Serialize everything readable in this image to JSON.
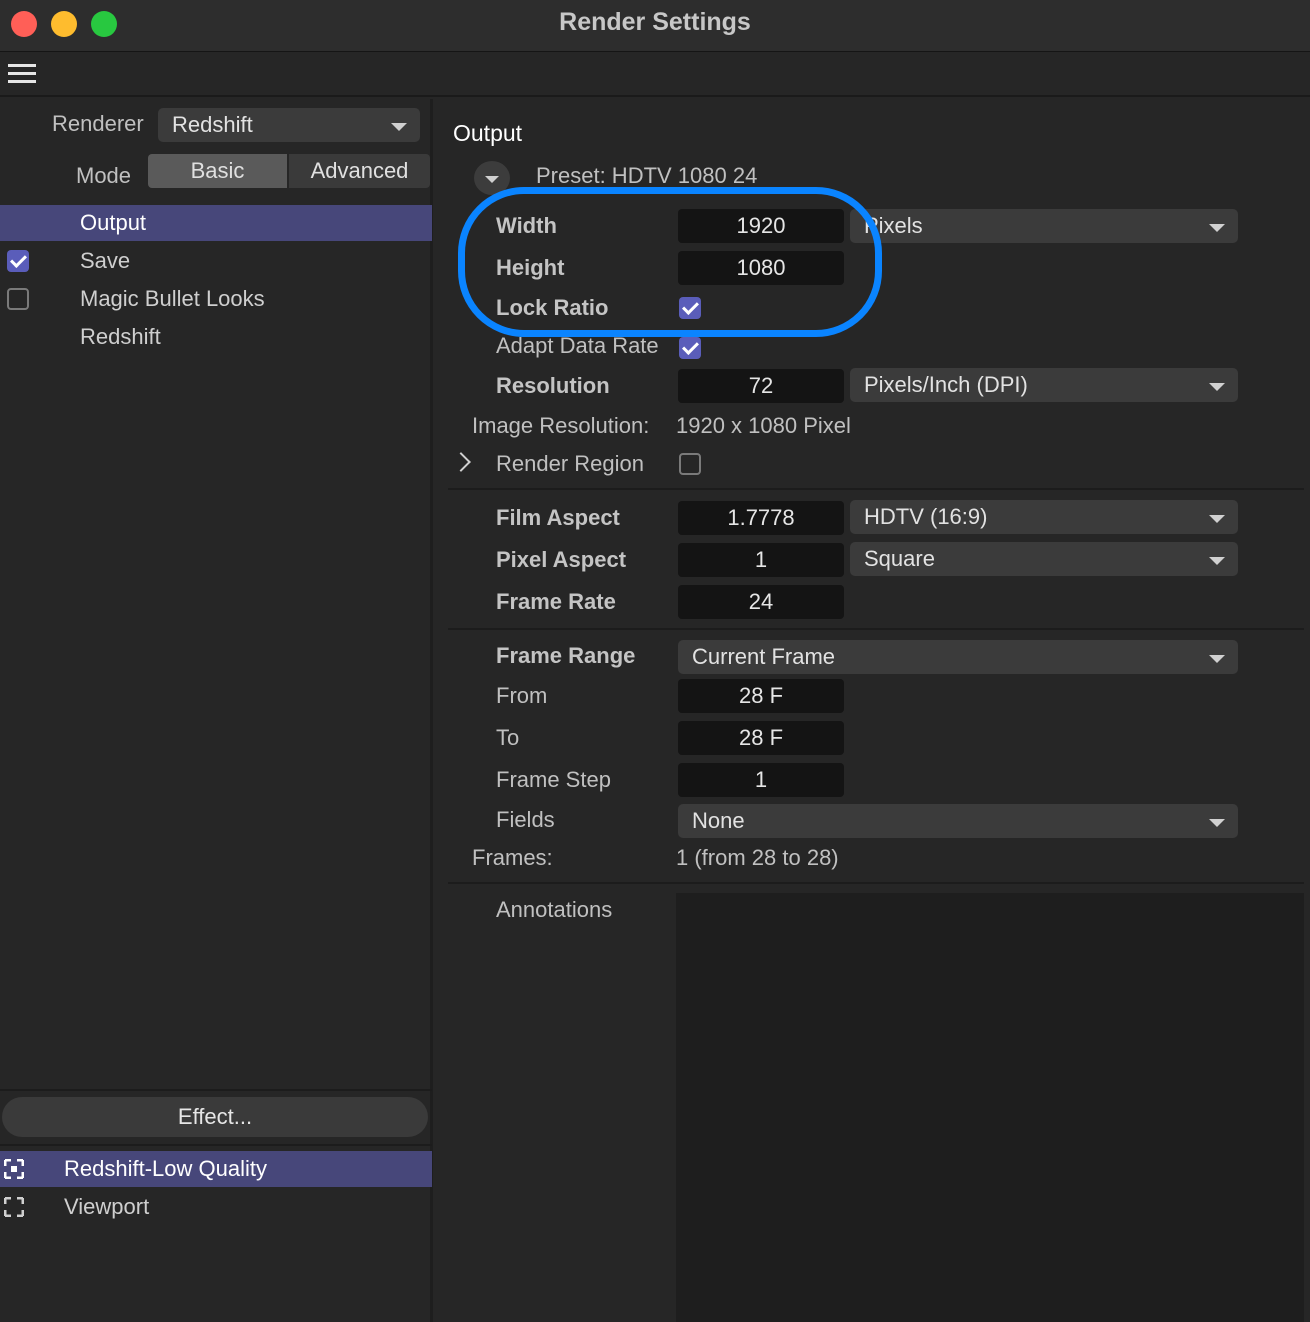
{
  "window": {
    "title": "Render Settings"
  },
  "sidebar": {
    "renderer_label": "Renderer",
    "renderer_value": "Redshift",
    "mode_label": "Mode",
    "mode_basic": "Basic",
    "mode_advanced": "Advanced",
    "items": [
      {
        "label": "Output",
        "selected": true,
        "checkbox": "none"
      },
      {
        "label": "Save",
        "selected": false,
        "checkbox": "checked"
      },
      {
        "label": "Magic Bullet Looks",
        "selected": false,
        "checkbox": "unchecked"
      },
      {
        "label": "Redshift",
        "selected": false,
        "checkbox": "none"
      }
    ],
    "effect_button": "Effect...",
    "render_settings": [
      {
        "label": "Redshift-Low Quality",
        "selected": true
      },
      {
        "label": "Viewport",
        "selected": false
      }
    ]
  },
  "output": {
    "heading": "Output",
    "preset": "Preset: HDTV 1080 24",
    "width_label": "Width",
    "width_value": "1920",
    "units_value": "Pixels",
    "height_label": "Height",
    "height_value": "1080",
    "lock_ratio_label": "Lock Ratio",
    "lock_ratio_checked": true,
    "adapt_data_rate_label": "Adapt Data Rate",
    "adapt_data_rate_checked": true,
    "resolution_label": "Resolution",
    "resolution_value": "72",
    "resolution_units": "Pixels/Inch (DPI)",
    "image_resolution_label": "Image Resolution:",
    "image_resolution_value": "1920 x 1080 Pixel",
    "render_region_label": "Render Region",
    "render_region_checked": false,
    "film_aspect_label": "Film Aspect",
    "film_aspect_value": "1.7778",
    "film_aspect_preset": "HDTV (16:9)",
    "pixel_aspect_label": "Pixel Aspect",
    "pixel_aspect_value": "1",
    "pixel_aspect_preset": "Square",
    "frame_rate_label": "Frame Rate",
    "frame_rate_value": "24",
    "frame_range_label": "Frame Range",
    "frame_range_value": "Current Frame",
    "from_label": "From",
    "from_value": "28 F",
    "to_label": "To",
    "to_value": "28 F",
    "frame_step_label": "Frame Step",
    "frame_step_value": "1",
    "fields_label": "Fields",
    "fields_value": "None",
    "frames_label": "Frames:",
    "frames_value": "1 (from 28 to 28)",
    "annotations_label": "Annotations",
    "annotations_value": ""
  },
  "colors": {
    "accent_selection": "#47477a",
    "checkbox_on": "#5a5dba",
    "highlight_ring": "#0a84ff"
  }
}
